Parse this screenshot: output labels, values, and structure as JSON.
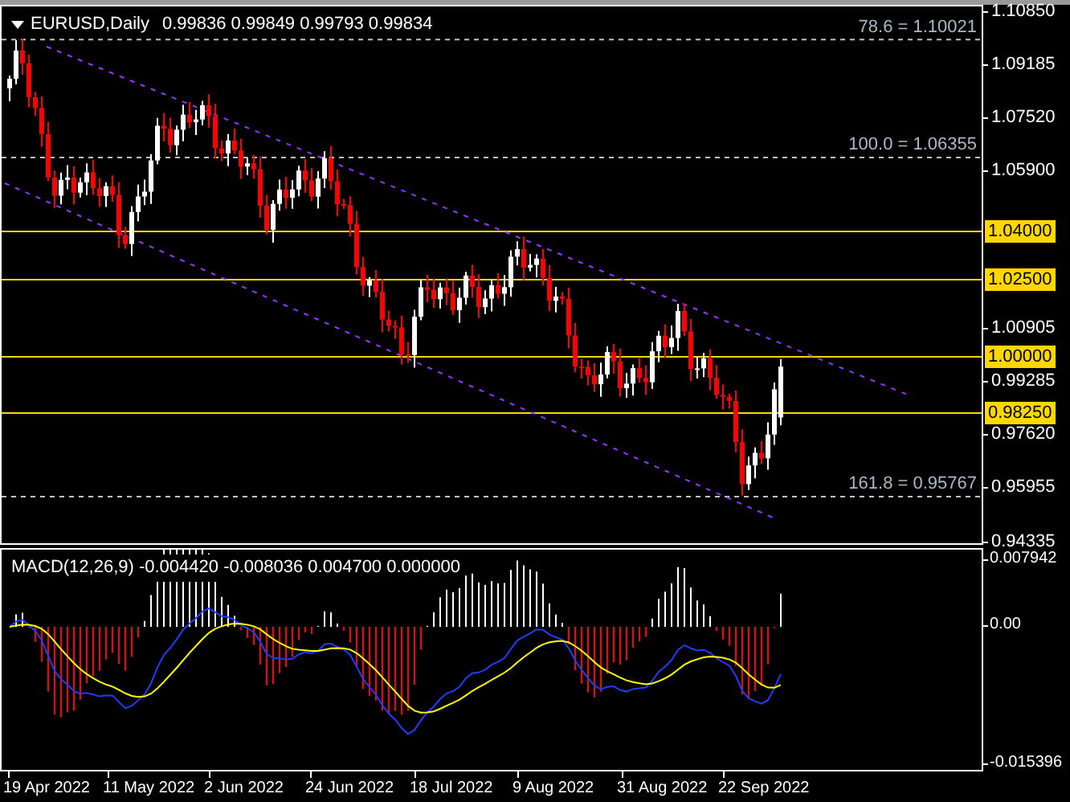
{
  "header": {
    "symbol": "EURUSD,Daily",
    "ohlc": "0.99836 0.99849 0.99793 0.99834"
  },
  "price_axis": [
    {
      "text": "1.10850",
      "kind": "tick"
    },
    {
      "text": "1.09185",
      "kind": "tick"
    },
    {
      "text": "1.07520",
      "kind": "tick"
    },
    {
      "text": "1.05900",
      "kind": "tick"
    },
    {
      "text": "1.04000",
      "kind": "level"
    },
    {
      "text": "1.02500",
      "kind": "level"
    },
    {
      "text": "1.00905",
      "kind": "tick"
    },
    {
      "text": "1.00000",
      "kind": "level"
    },
    {
      "text": "0.99285",
      "kind": "tick"
    },
    {
      "text": "0.98250",
      "kind": "level"
    },
    {
      "text": "0.97620",
      "kind": "tick"
    },
    {
      "text": "0.95955",
      "kind": "tick"
    },
    {
      "text": "0.94335",
      "kind": "tick"
    }
  ],
  "fib_levels": [
    "78.6 = 1.10021",
    "100.0 = 1.06355",
    "161.8 = 0.95767"
  ],
  "macd": {
    "label": "MACD(12,26,9) -0.004420 -0.008036 0.004700 0.000000",
    "axis": [
      "0.007942",
      "0.00",
      "-0.015396"
    ]
  },
  "dates": [
    "19 Apr 2022",
    "11 May 2022",
    "2 Jun 2022",
    "24 Jun 2022",
    "18 Jul 2022",
    "9 Aug 2022",
    "31 Aug 2022",
    "22 Sep 2022"
  ]
}
